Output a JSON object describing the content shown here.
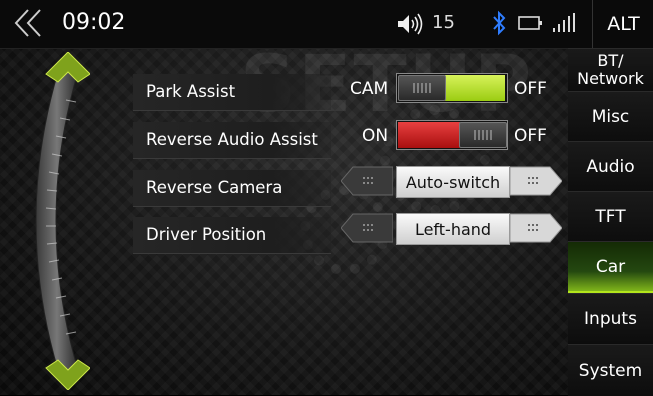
{
  "status": {
    "time": "09:02",
    "volume": "15",
    "alt_label": "ALT"
  },
  "watermark": "SETUP",
  "rows": [
    {
      "label": "Park Assist",
      "left_text": "CAM",
      "right_text": "OFF",
      "state": "OFF",
      "active_color": "#b3e61c"
    },
    {
      "label": "Reverse Audio Assist",
      "left_text": "ON",
      "right_text": "OFF",
      "state": "ON",
      "active_color": "#d21f1f"
    },
    {
      "label": "Reverse Camera",
      "value": "Auto-switch"
    },
    {
      "label": "Driver Position",
      "value": "Left-hand"
    }
  ],
  "sidebar": {
    "items": [
      {
        "label": "BT/\nNetwork"
      },
      {
        "label": "Misc"
      },
      {
        "label": "Audio"
      },
      {
        "label": "TFT"
      },
      {
        "label": "Car",
        "active": true
      },
      {
        "label": "Inputs"
      },
      {
        "label": "System"
      }
    ]
  }
}
